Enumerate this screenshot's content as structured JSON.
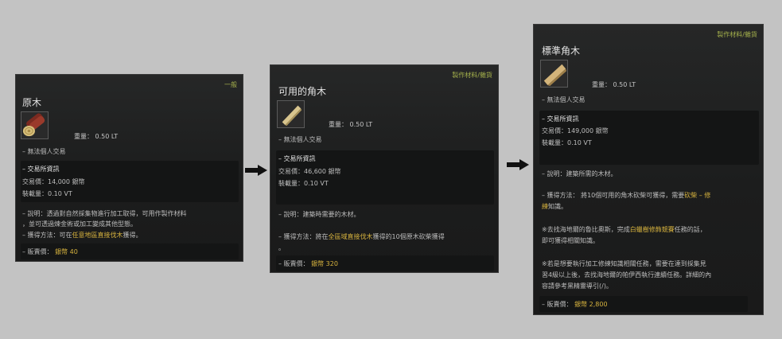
{
  "card1": {
    "category": "一般",
    "title": "原木",
    "icon": "log-icon",
    "weight": "重量： 0.50 LT",
    "no_trade": "– 無法個人交易",
    "market_header": "– 交易所資訊",
    "price": "交易價：14,000 銀幣",
    "load": "裝載量：0.10 VT",
    "desc_1": "– 說明：透過對自然採集物進行加工取得，可用作製作材料",
    "desc_2": "，並可透過煉金術或加工變成其他型態。",
    "obtain_label": "– 獲得方法：可在",
    "obtain_highlight": "任意地區直接伐木",
    "obtain_suffix": "獲得。",
    "sell_label": "– 販賣價：",
    "sell_value": "銀幣 40"
  },
  "card2": {
    "category": "製作材料/雜貨",
    "title": "可用的角木",
    "icon": "usable-plank-icon",
    "weight": "重量： 0.50 LT",
    "no_trade": "– 無法個人交易",
    "market_header": "– 交易所資訊",
    "price": "交易價：46,600 銀幣",
    "load": "裝載量：0.10 VT",
    "desc": "– 說明：建築時需要的木材。",
    "obtain_label": "– 獲得方法：將在",
    "obtain_highlight": "全區域直接伐木",
    "obtain_suffix": "獲得的10個原木砍柴獲得",
    "obtain_cont": "。",
    "sell_label": "– 販賣價：",
    "sell_value": "銀幣 320"
  },
  "card3": {
    "category": "製作材料/雜貨",
    "title": "標準角木",
    "icon": "standard-plank-icon",
    "weight": "重量： 0.50 LT",
    "no_trade": "– 無法個人交易",
    "market_header": "– 交易所資訊",
    "price": "交易價：149,000 銀幣",
    "load": "裝載量：0.10 VT",
    "desc": "– 說明：建築所需的木材。",
    "obtain_label": "– 獲得方法： 將10個可用的角木砍柴可獲得，需要",
    "obtain_highlight": "砍柴 – 修",
    "obtain_cont_highlight": "練",
    "obtain_cont": "知識。",
    "note1_prefix": "※去找海地爾的魯比奧斯，完成",
    "note1_highlight": "白蠟樹修飾競賽",
    "note1_suffix": "任務的話，",
    "note1_line2": "即可獲得相關知識。",
    "note2_line1": "※若是想要執行加工修練知識相關任務，需要在達到採集見",
    "note2_line2": "習4級以上後，去找海地爾的帕伊西執行連續任務。詳細的內",
    "note2_line3": "容請參考黑精靈導引(/)。",
    "sell_label": "– 販賣價：",
    "sell_value": "銀幣 2,800"
  },
  "arrows": [
    "arrow-right-icon",
    "arrow-right-icon"
  ]
}
